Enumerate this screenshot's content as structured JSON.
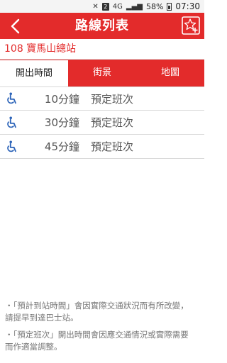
{
  "status_bar": {
    "sim_label": "2",
    "network_label": "4G",
    "battery_percent": "58%",
    "time": "07:30"
  },
  "app_bar": {
    "title": "路線列表",
    "back_icon": "chevron-left-icon",
    "favorite_icon": "star-add-icon"
  },
  "route": {
    "label": "108 寶馬山總站"
  },
  "tabs": [
    {
      "label": "開出時間",
      "active": true
    },
    {
      "label": "街景",
      "active": false
    },
    {
      "label": "地圖",
      "active": false
    }
  ],
  "departures": [
    {
      "time": "10分鐘",
      "type": "預定班次",
      "icon": "wheelchair-icon"
    },
    {
      "time": "30分鐘",
      "type": "預定班次",
      "icon": "wheelchair-icon"
    },
    {
      "time": "45分鐘",
      "type": "預定班次",
      "icon": "wheelchair-icon"
    }
  ],
  "notes": [
    "・「預計到站時間」會因實際交通狀況而有所改變，請提早到達巴士站。",
    "・「預定班次」開出時間會因應交通情況或實際需要而作適當調整。"
  ],
  "colors": {
    "brand_red": "#e32b2b",
    "wheelchair_blue": "#2a62b8"
  }
}
